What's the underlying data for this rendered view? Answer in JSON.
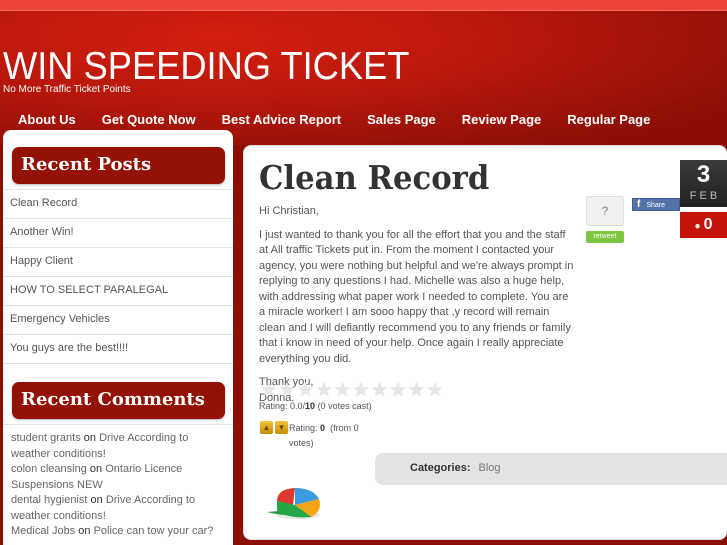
{
  "site": {
    "title": "WIN SPEEDING TICKET",
    "tagline": "No More Traffic Ticket Points"
  },
  "nav": {
    "items": [
      {
        "label": "About Us"
      },
      {
        "label": "Get Quote Now"
      },
      {
        "label": "Best Advice Report"
      },
      {
        "label": "Sales Page"
      },
      {
        "label": "Review Page"
      },
      {
        "label": "Regular Page"
      }
    ]
  },
  "sidebar": {
    "recent_posts_title": "Recent Posts",
    "recent_posts": [
      "Clean Record",
      "Another Win!",
      "Happy Client",
      "HOW TO SELECT PARALEGAL",
      "Emergency Vehicles",
      "You guys are the best!!!!"
    ],
    "recent_comments_title": "Recent Comments",
    "recent_comments": [
      {
        "author": "student grants",
        "on": "on",
        "post": "Drive According to weather conditions!"
      },
      {
        "author": "colon cleansing",
        "on": "on",
        "post": "Ontario Licence Suspensions NEW"
      },
      {
        "author": "dental hygienist",
        "on": "on",
        "post": "Drive According to weather conditions!"
      },
      {
        "author": "Medical Jobs",
        "on": "on",
        "post": "Police can tow your car?"
      }
    ]
  },
  "post": {
    "title": "Clean Record",
    "greeting": "Hi Christian,",
    "body": "I just wanted to thank you for all the effort that you and the staff at All traffic Tickets put in. From the moment I contacted your agency, you were nothing but helpful and we're always prompt in replying to any questions I had. Michelle was also a huge help, with addressing what paper work I needed to complete. You are a miracle worker! I am sooo happy that ,y record will remain clean and I will defiantly recommend you to any friends or family that i know in need of your help. Once again I really appreciate everything you did.",
    "closing": "Thank you,",
    "signature": "Donna.",
    "date_day": "3",
    "date_month": "FEB",
    "comment_count": "0",
    "share_count": "?",
    "retweet_label": "retweet",
    "fb_share_label": "Share",
    "fb_icon": "f",
    "star_rating": {
      "value": 0.0,
      "max": 10,
      "stars_total": 10,
      "label_prefix": "Rating: 0.0/",
      "max_label": "10",
      "votes_label": "(0 votes cast)"
    },
    "thumb_rating": {
      "label": "Rating:",
      "value": "0",
      "votes_label": "(from 0 votes)"
    },
    "categories_label": "Categories:",
    "category": "Blog"
  },
  "colors": {
    "brand_red": "#941106",
    "header_red": "#c61a0c",
    "date_badge": "#2b2b2b",
    "comment_badge": "#c4140a",
    "retweet_green": "#7dc640",
    "facebook_blue": "#5471a8"
  }
}
